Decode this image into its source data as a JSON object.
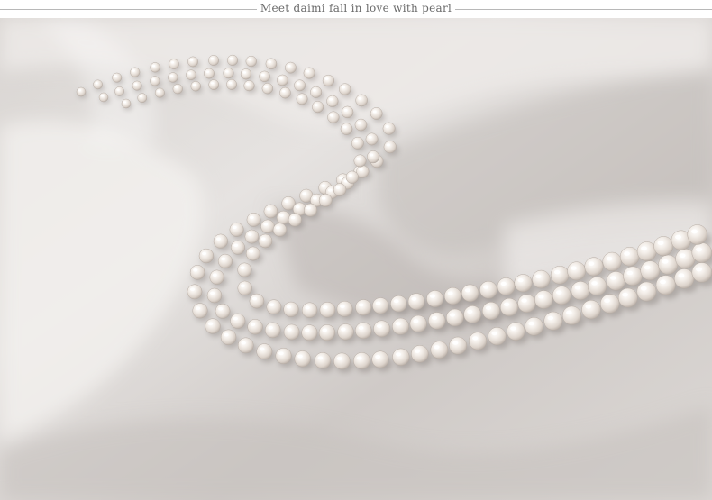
{
  "header": {
    "tagline": "Meet daimi fall in love with pearl"
  },
  "photo": {
    "subject": "pearl-necklace-on-satin",
    "colors": {
      "satin_light": "#e7e4e2",
      "satin_mid": "#cfcbc8",
      "satin_shadow": "#a9a4a1",
      "pearl_highlight": "#ffffff",
      "pearl_body": "#efe9e3",
      "pearl_shade": "#c9c0b8"
    }
  }
}
